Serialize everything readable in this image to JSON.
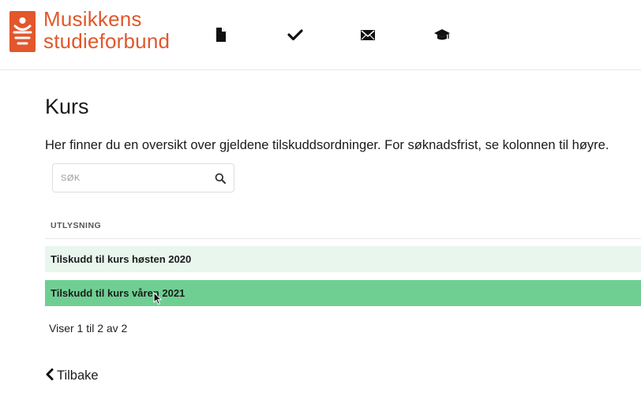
{
  "brand": {
    "name_line1": "Musikkens",
    "name_line2": "studieforbund",
    "color": "#e2572b"
  },
  "nav": {
    "icons": [
      "document-icon",
      "checkmark-icon",
      "envelope-icon",
      "graduation-cap-icon"
    ]
  },
  "page": {
    "title": "Kurs",
    "intro": "Her finner du en oversikt over gjeldene tilskuddsordninger. For søknadsfrist, se kolonnen til høyre."
  },
  "search": {
    "placeholder": "SØK",
    "value": ""
  },
  "table": {
    "column_header": "UTLYSNING",
    "rows": [
      {
        "label": "Tilskudd til kurs høsten 2020"
      },
      {
        "label": "Tilskudd til kurs våren 2021"
      }
    ],
    "info": "Viser 1 til 2 av 2",
    "row_colors": {
      "normal": "#e8f6ee",
      "hover": "#6fcf93"
    }
  },
  "back": {
    "label": "Tilbake"
  }
}
